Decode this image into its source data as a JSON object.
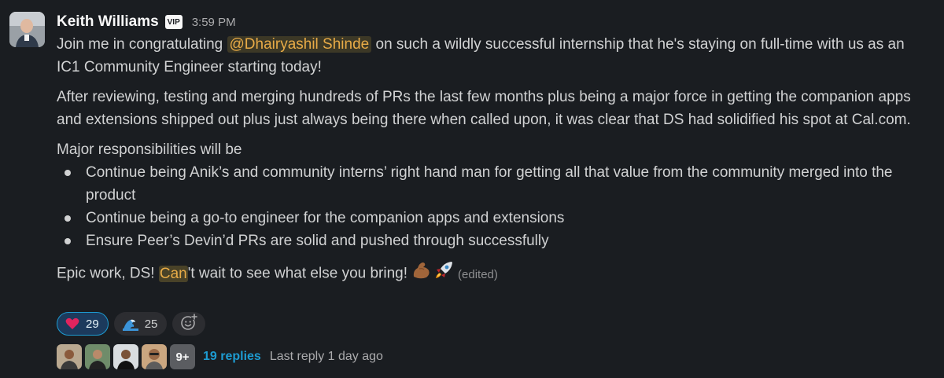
{
  "message": {
    "sender": "Keith Williams",
    "badge": "VIP",
    "time": "3:59 PM",
    "intro_before": "Join me in congratulating ",
    "mention": "@Dhairyashil Shinde",
    "intro_after": " on such a wildly successful internship that he's staying on full-time with us as an IC1 Community Engineer starting today!",
    "paragraph2": "After reviewing, testing and merging hundreds of PRs the last few months plus being a major force in getting the companion apps and extensions shipped out plus just always being there when called upon, it was clear that DS had solidified his spot at Cal.com.",
    "responsibilities_heading": "Major responsibilities will be",
    "responsibilities": [
      "Continue being Anik’s and community interns’ right hand man for getting all that value from the community merged into the product",
      "Continue being a go-to engineer for the companion apps and extensions",
      "Ensure Peer’s Devin’d PRs are solid and pushed through successfully"
    ],
    "closing_before": "Epic work, DS! ",
    "closing_highlight": "Can",
    "closing_after": "'t wait to see what else you bring!",
    "closing_emojis": [
      "flexed-biceps-emoji",
      "rocket-emoji"
    ],
    "edited_label": "(edited)"
  },
  "reactions": [
    {
      "emoji": "red-heart-emoji",
      "count": "29",
      "active": true
    },
    {
      "emoji": "wave-emoji",
      "count": "25",
      "active": false
    }
  ],
  "add_reaction_icon": "add-reaction-icon",
  "thread": {
    "more_label": "9+",
    "replies_label": "19 replies",
    "last_reply_label": "Last reply 1 day ago"
  },
  "colors": {
    "background": "#1a1d21",
    "text": "#d1d2d3",
    "mention": "#e8ab47",
    "link": "#1d9bd1",
    "active_reaction_bg": "#1c3a5c",
    "active_reaction_border": "#1d9bd1"
  }
}
